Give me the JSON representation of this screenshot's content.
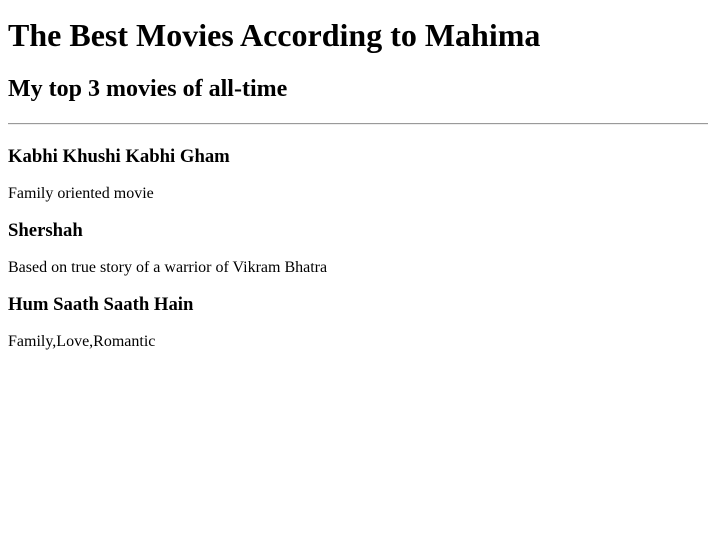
{
  "page": {
    "title": "The Best Movies According to Mahima",
    "subtitle": "My top 3 movies of all-time"
  },
  "movies": [
    {
      "title": "Kabhi Khushi Kabhi Gham",
      "description": "Family oriented movie"
    },
    {
      "title": "Shershah",
      "description": "Based on true story of a warrior of Vikram Bhatra"
    },
    {
      "title": "Hum Saath Saath Hain",
      "description": "Family,Love,Romantic"
    }
  ]
}
